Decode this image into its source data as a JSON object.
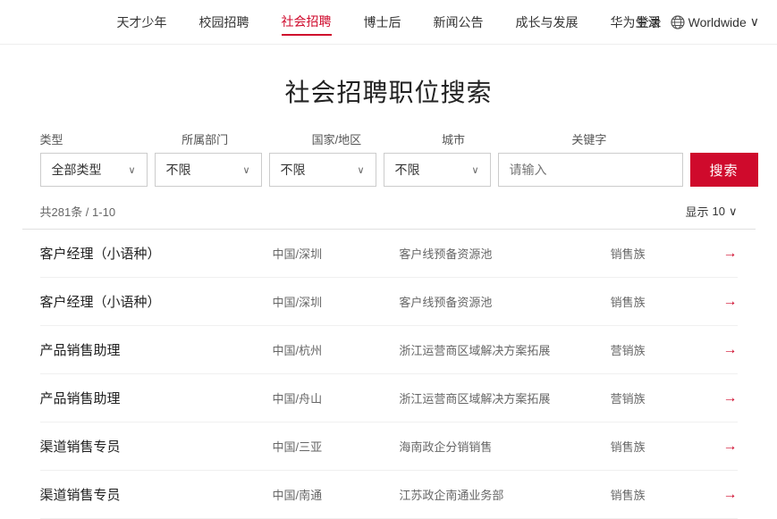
{
  "nav": {
    "items": [
      {
        "label": "天才少年",
        "active": false
      },
      {
        "label": "校园招聘",
        "active": false
      },
      {
        "label": "社会招聘",
        "active": true
      },
      {
        "label": "博士后",
        "active": false
      },
      {
        "label": "新闻公告",
        "active": false
      },
      {
        "label": "成长与发展",
        "active": false
      },
      {
        "label": "华为生活",
        "active": false
      }
    ],
    "login_label": "登录",
    "worldwide_label": "Worldwide"
  },
  "page": {
    "title": "社会招聘职位搜索"
  },
  "filters": {
    "type_label": "类型",
    "dept_label": "所属部门",
    "country_label": "国家/地区",
    "city_label": "城市",
    "keyword_label": "关键字",
    "type_value": "全部类型",
    "dept_value": "不限",
    "country_value": "不限",
    "city_value": "不限",
    "keyword_placeholder": "请输入",
    "search_button": "搜索"
  },
  "results": {
    "summary": "共281条 / 1-10",
    "display_label": "显示",
    "display_count": "10",
    "chevron": "∨"
  },
  "jobs": [
    {
      "title": "客户经理（小语种）",
      "location": "中国/深圳",
      "dept": "客户线预备资源池",
      "category": "销售族"
    },
    {
      "title": "客户经理（小语种）",
      "location": "中国/深圳",
      "dept": "客户线预备资源池",
      "category": "销售族"
    },
    {
      "title": "产品销售助理",
      "location": "中国/杭州",
      "dept": "浙江运营商区域解决方案拓展",
      "category": "营销族"
    },
    {
      "title": "产品销售助理",
      "location": "中国/舟山",
      "dept": "浙江运营商区域解决方案拓展",
      "category": "营销族"
    },
    {
      "title": "渠道销售专员",
      "location": "中国/三亚",
      "dept": "海南政企分销销售",
      "category": "销售族"
    },
    {
      "title": "渠道销售专员",
      "location": "中国/南通",
      "dept": "江苏政企南通业务部",
      "category": "销售族"
    }
  ],
  "colors": {
    "accent": "#CF0A2C"
  }
}
